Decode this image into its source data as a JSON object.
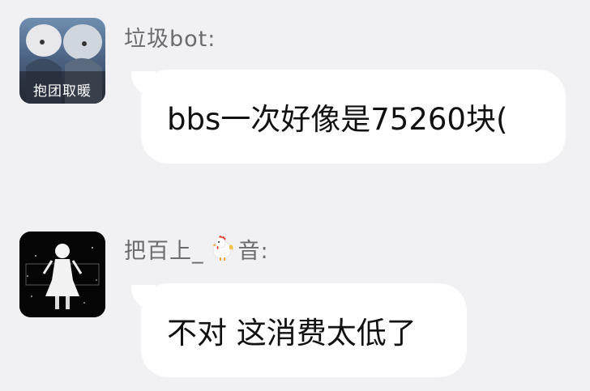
{
  "messages": [
    {
      "sender": "垃圾bot:",
      "avatar_caption": "抱团取暖",
      "text": "bbs一次好像是75260块("
    },
    {
      "sender_prefix": "把百上_",
      "sender_icon": "rooster-icon",
      "sender_suffix": "音:",
      "text": "不对 这消费太低了"
    }
  ],
  "colors": {
    "background": "#f1f1f3",
    "bubble": "#ffffff",
    "name": "#6b6b70"
  }
}
